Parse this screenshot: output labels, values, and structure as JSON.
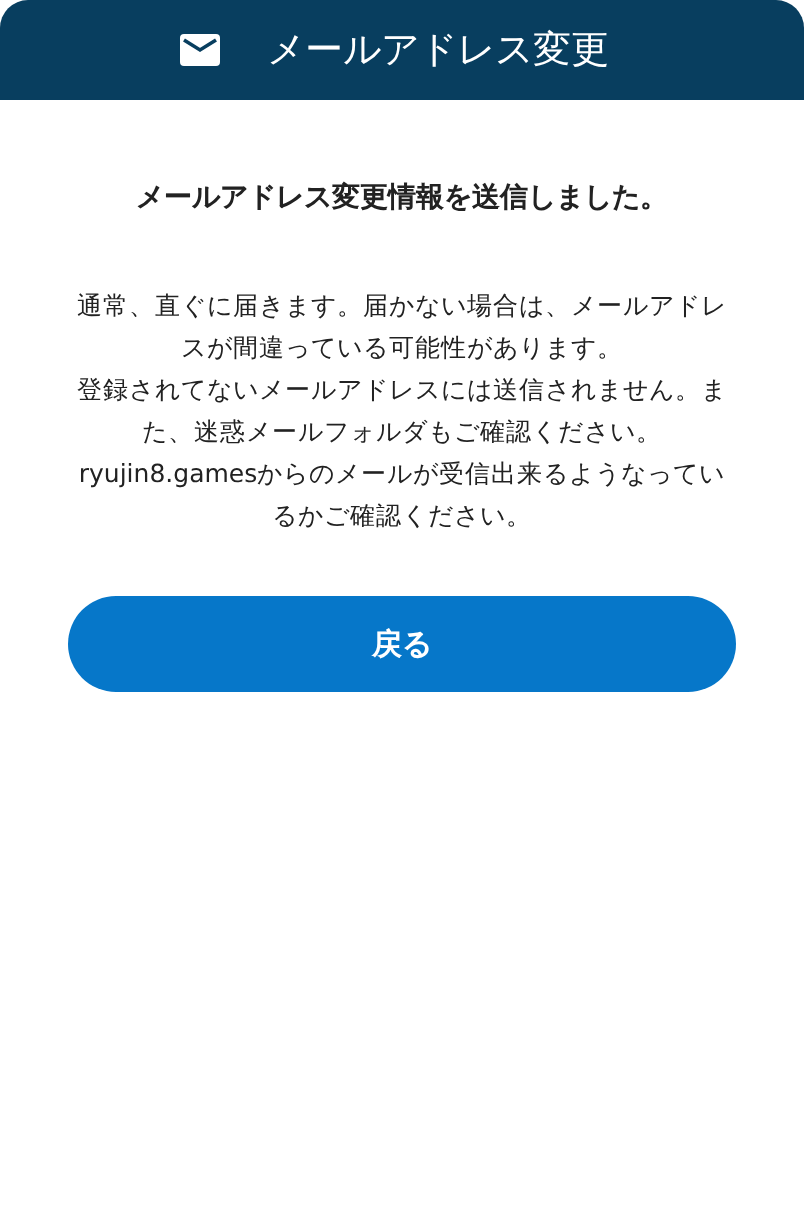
{
  "header": {
    "title": "メールアドレス変更"
  },
  "heading": "メールアドレス変更情報を送信しました。",
  "paragraphs": [
    "通常、直ぐに届きます。届かない場合は、メールアドレスが間違っている可能性があります。",
    "登録されてないメールアドレスには送信されません。また、迷惑メールフォルダもご確認ください。ryujin8.gamesからのメールが受信出来るようなっているかご確認ください。"
  ],
  "buttons": [
    "戻る"
  ]
}
